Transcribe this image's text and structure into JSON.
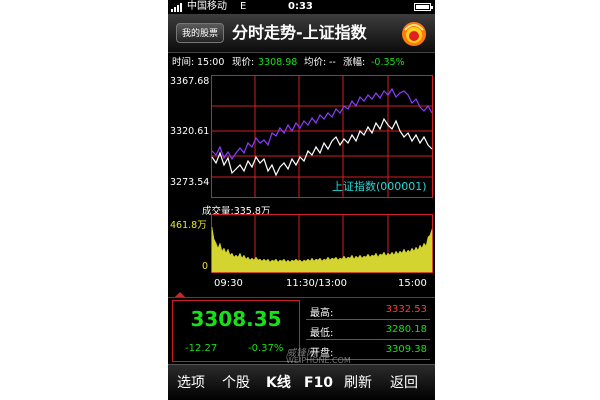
{
  "status_bar": {
    "carrier": "中国移动",
    "network": "E",
    "time": "0:33"
  },
  "header": {
    "back_label": "我的股票",
    "title": "分时走势-上证指数"
  },
  "info": {
    "time_label": "时间:",
    "time": "15:00",
    "price_label": "现价:",
    "price": "3308.98",
    "avg_label": "均价:",
    "avg": "--",
    "change_label": "涨幅:",
    "change": "-0.35%"
  },
  "price_chart": {
    "ylabels": [
      "3367.68",
      "3320.61",
      "3273.54"
    ],
    "index_name": "上证指数(000001)",
    "colors": {
      "price_line": "#ffffff",
      "avg_line": "#8a3cff",
      "grid": "#d02020"
    }
  },
  "volume_chart": {
    "label": "成交量:",
    "value": "335.8万",
    "ylabels": [
      "461.8万",
      "0"
    ],
    "color": "#d4d430"
  },
  "time_axis": [
    "09:30",
    "11:30/13:00",
    "15:00"
  ],
  "quote": {
    "price": "3308.35",
    "change": "-12.27",
    "change_pct": "-0.37%"
  },
  "stats": [
    {
      "label": "最高:",
      "value": "3332.53",
      "color": "#ff3a3a"
    },
    {
      "label": "最低:",
      "value": "3280.18",
      "color": "#18e018"
    },
    {
      "label": "开盘:",
      "value": "3309.38",
      "color": "#18e018"
    }
  ],
  "watermark": {
    "line1": "威锋网",
    "line2": "WEIPHONE.COM"
  },
  "toolbar": [
    "选项",
    "个股",
    "K线",
    "F10",
    "刷新",
    "返回"
  ]
}
